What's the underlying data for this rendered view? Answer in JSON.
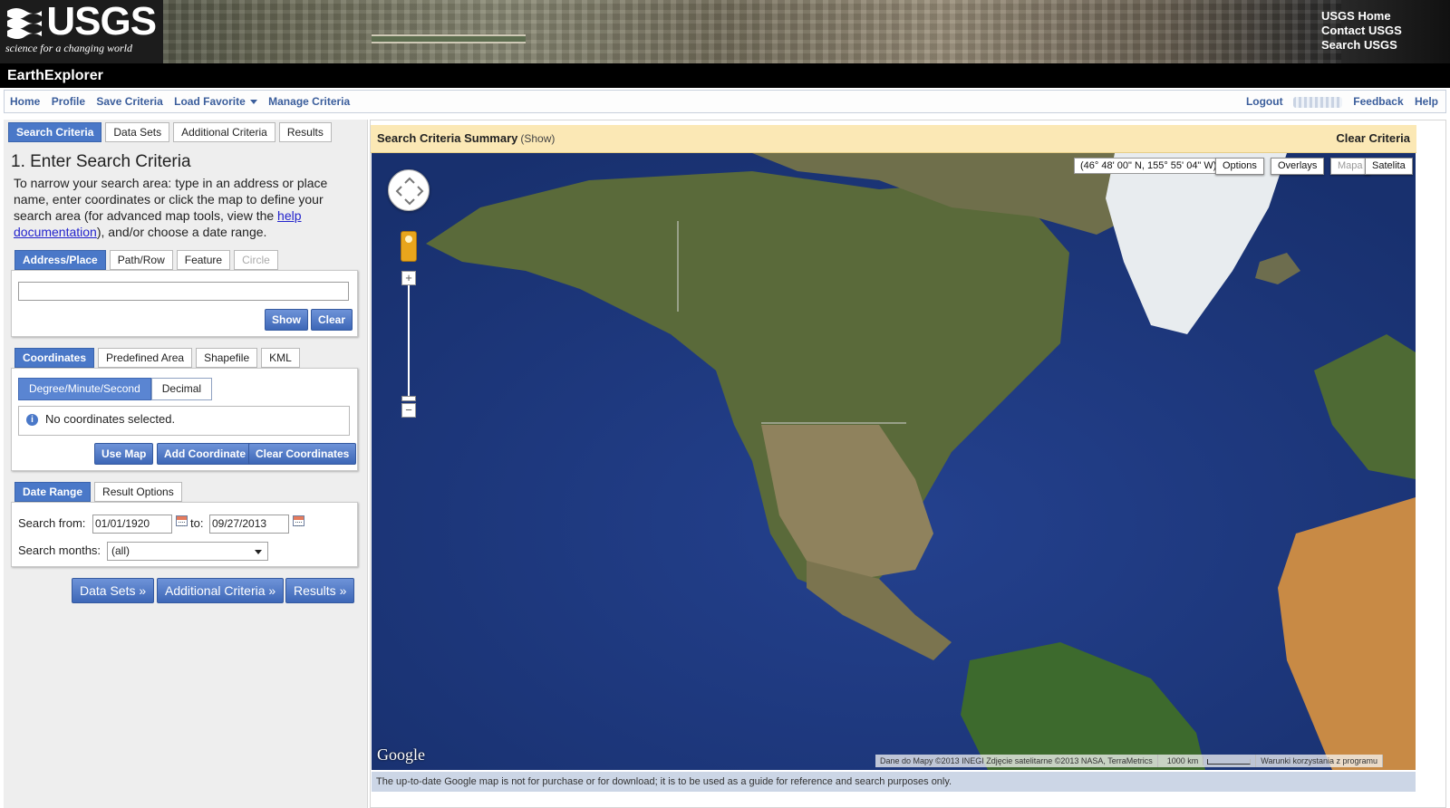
{
  "header": {
    "logo_text": "USGS",
    "logo_tagline": "science for a changing world",
    "links": [
      "USGS Home",
      "Contact USGS",
      "Search USGS"
    ]
  },
  "app": {
    "title": "EarthExplorer"
  },
  "nav": {
    "left": [
      "Home",
      "Profile",
      "Save Criteria",
      "Load Favorite",
      "Manage Criteria"
    ],
    "right": [
      "Logout",
      "Feedback",
      "Help"
    ]
  },
  "main_tabs": [
    "Search Criteria",
    "Data Sets",
    "Additional Criteria",
    "Results"
  ],
  "step": {
    "heading": "1. Enter Search Criteria",
    "help_before": "To narrow your search area: type in an address or place name, enter coordinates or click the map to define your search area (for advanced map tools, view the ",
    "help_link": "help documentation",
    "help_after": "), and/or choose a date range."
  },
  "area_tabs": [
    "Address/Place",
    "Path/Row",
    "Feature",
    "Circle"
  ],
  "address": {
    "value": "",
    "show_label": "Show",
    "clear_label": "Clear"
  },
  "coord_tabs": [
    "Coordinates",
    "Predefined Area",
    "Shapefile",
    "KML"
  ],
  "coord_format": [
    "Degree/Minute/Second",
    "Decimal"
  ],
  "coords": {
    "empty_message": "No coordinates selected.",
    "use_map": "Use Map",
    "add": "Add Coordinate",
    "clear": "Clear Coordinates"
  },
  "date_tabs": [
    "Date Range",
    "Result Options"
  ],
  "date": {
    "from_label": "Search from:",
    "from_value": "01/01/1920",
    "to_label": "to:",
    "to_value": "09/27/2013",
    "months_label": "Search months:",
    "months_value": "(all)"
  },
  "step_buttons": [
    "Data Sets »",
    "Additional Criteria »",
    "Results »"
  ],
  "summary": {
    "title": "Search Criteria Summary",
    "show": "(Show)",
    "clear": "Clear Criteria"
  },
  "map": {
    "coordinate_readout": "(46° 48' 00\" N, 155° 55' 04\" W)",
    "controls": [
      "Options",
      "Overlays"
    ],
    "map_types": [
      "Mapa",
      "Satelita"
    ],
    "attribution": "Dane do Mapy ©2013 INEGI Zdjęcie satelitarne ©2013 NASA, TerraMetrics",
    "scale": "1000 km",
    "terms": "Warunki korzystania z programu",
    "provider": "Google",
    "notice": "The up-to-date Google map is not for purchase or for download; it is to be used as a guide for reference and search purposes only."
  },
  "colors": {
    "accent": "#4a78c8",
    "summary_bg": "#fbe8b5",
    "ocean": "#1f3a82",
    "nav_link": "#3b5e9c"
  }
}
